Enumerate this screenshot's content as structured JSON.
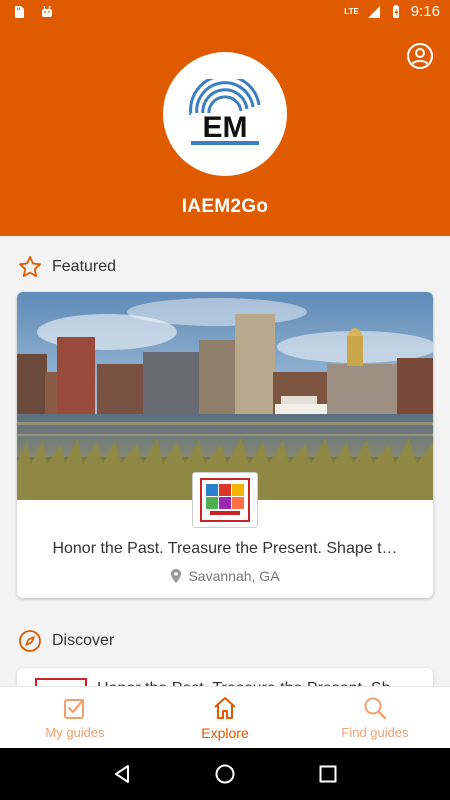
{
  "status_bar": {
    "time": "9:16",
    "network": "LTE"
  },
  "header": {
    "app_title": "IAEM2Go",
    "logo_text": "EM"
  },
  "featured": {
    "section_label": "Featured",
    "card": {
      "title": "Honor the Past. Treasure the Present. Shape t…",
      "location": "Savannah, GA"
    }
  },
  "discover": {
    "section_label": "Discover",
    "peek_title": "Honor the Past. Treasure the Present. Sh"
  },
  "bottom_nav": {
    "items": [
      {
        "label": "My guides",
        "icon": "checkbox-icon"
      },
      {
        "label": "Explore",
        "icon": "home-icon"
      },
      {
        "label": "Find guides",
        "icon": "search-icon"
      }
    ],
    "active": "Explore"
  },
  "colors": {
    "primary": "#e05a00",
    "primary_light": "#f0a070",
    "background": "#f3f3f3"
  }
}
